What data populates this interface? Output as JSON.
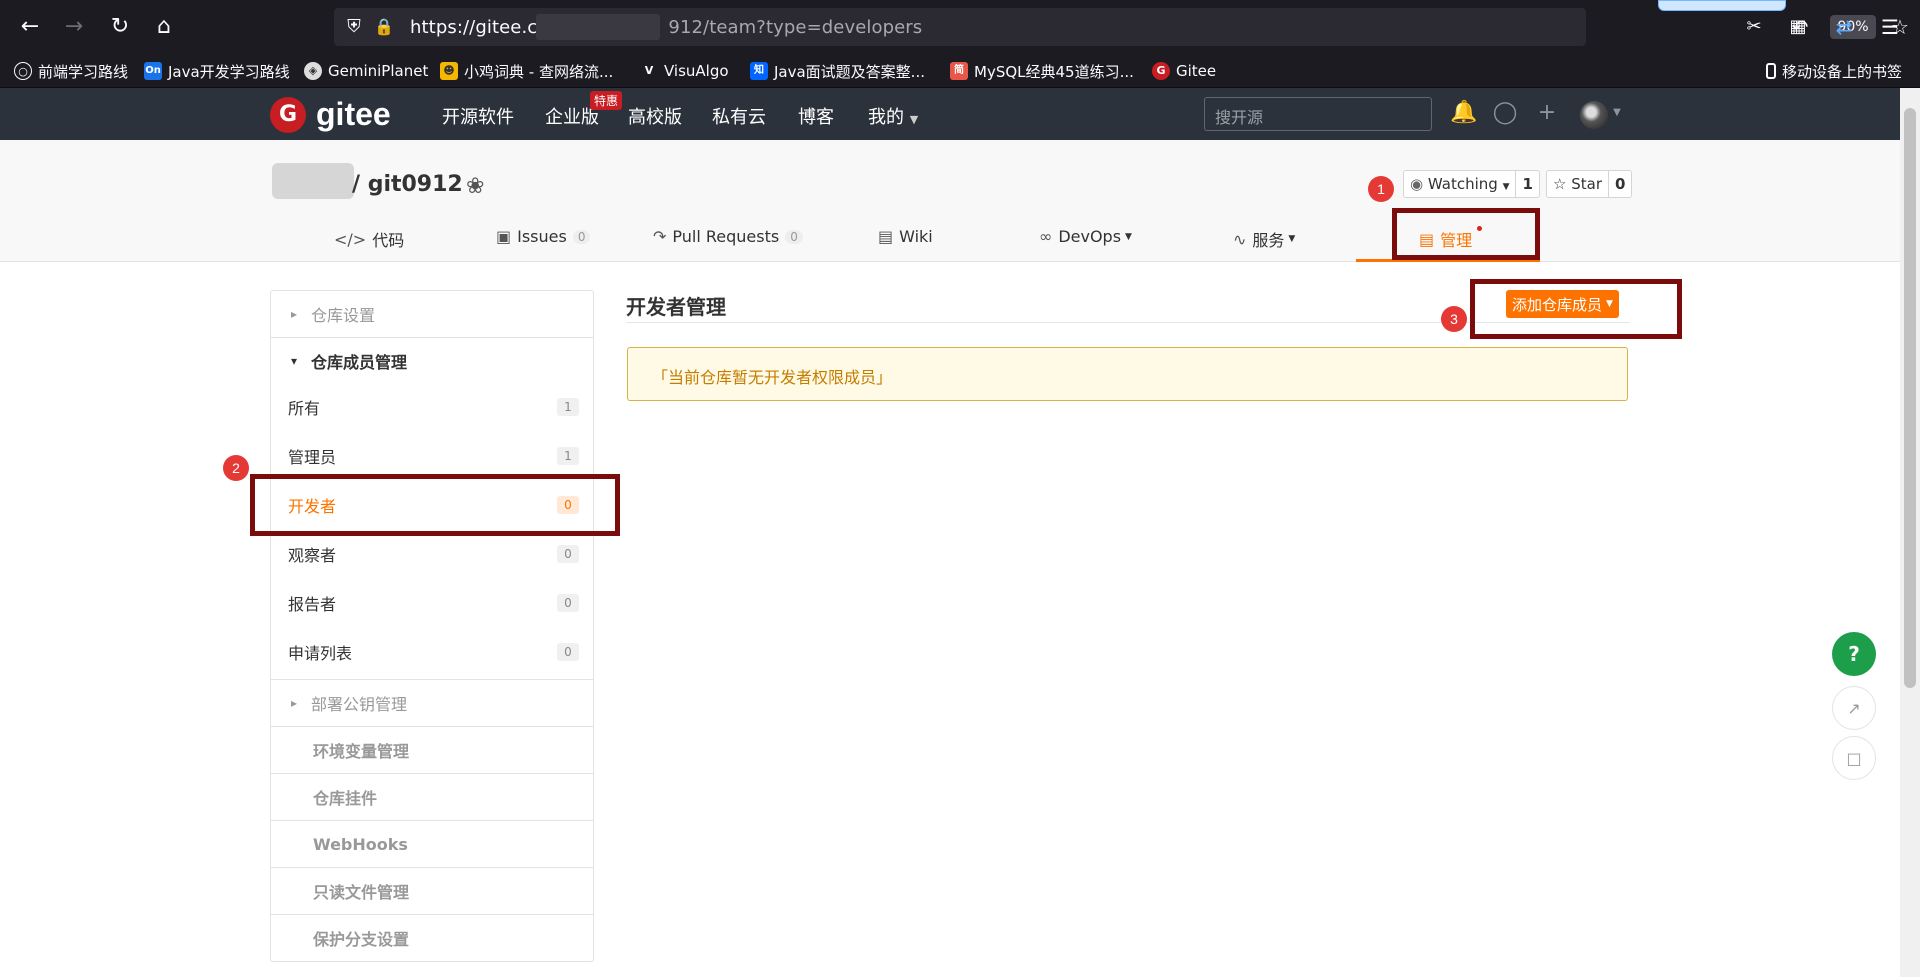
{
  "browser": {
    "url_prefix": "https://gitee.co",
    "url_suffix": "912/team?type=developers",
    "zoom": "90%",
    "bookmarks": [
      {
        "label": "前端学习路线",
        "icon": "globe-icon"
      },
      {
        "label": "Java开发学习路线",
        "icon": "on-icon"
      },
      {
        "label": "GeminiPlanet",
        "icon": "gemini-icon"
      },
      {
        "label": "小鸡词典 - 查网络流...",
        "icon": "chick-icon"
      },
      {
        "label": "VisuAlgo",
        "icon": "visualgo-icon"
      },
      {
        "label": "Java面试题及答案整...",
        "icon": "zhihu-icon"
      },
      {
        "label": "MySQL经典45道练习...",
        "icon": "jianshu-icon"
      },
      {
        "label": "Gitee",
        "icon": "gitee-icon"
      }
    ],
    "mobile_bookmarks": "移动设备上的书签"
  },
  "header": {
    "logo_mark": "G",
    "logo_text": "gitee",
    "nav": [
      "开源软件",
      "企业版",
      "高校版",
      "私有云",
      "博客",
      "我的"
    ],
    "hot_badge": "特惠",
    "search_placeholder": "搜开源"
  },
  "repo": {
    "title": "/ git0912",
    "watching_label": "Watching",
    "watching_count": "1",
    "star_label": "Star",
    "star_count": "0",
    "tabs": [
      {
        "label": "代码",
        "count": ""
      },
      {
        "label": "Issues",
        "count": "0"
      },
      {
        "label": "Pull Requests",
        "count": "0"
      },
      {
        "label": "Wiki",
        "count": ""
      },
      {
        "label": "DevOps",
        "count": ""
      },
      {
        "label": "服务",
        "count": ""
      },
      {
        "label": "管理",
        "count": ""
      }
    ]
  },
  "sidebar": {
    "repo_settings": "仓库设置",
    "member_mgmt": "仓库成员管理",
    "items": [
      {
        "label": "所有",
        "count": "1"
      },
      {
        "label": "管理员",
        "count": "1"
      },
      {
        "label": "开发者",
        "count": "0"
      },
      {
        "label": "观察者",
        "count": "0"
      },
      {
        "label": "报告者",
        "count": "0"
      },
      {
        "label": "申请列表",
        "count": "0"
      }
    ],
    "deploy_keys": "部署公钥管理",
    "subs": [
      "环境变量管理",
      "仓库挂件",
      "WebHooks",
      "只读文件管理",
      "保护分支设置"
    ]
  },
  "main": {
    "title": "开发者管理",
    "add_button": "添加仓库成员",
    "notice": "「当前仓库暂无开发者权限成员」"
  },
  "annotations": [
    "1",
    "2",
    "3"
  ],
  "fab": {
    "help": "?"
  }
}
